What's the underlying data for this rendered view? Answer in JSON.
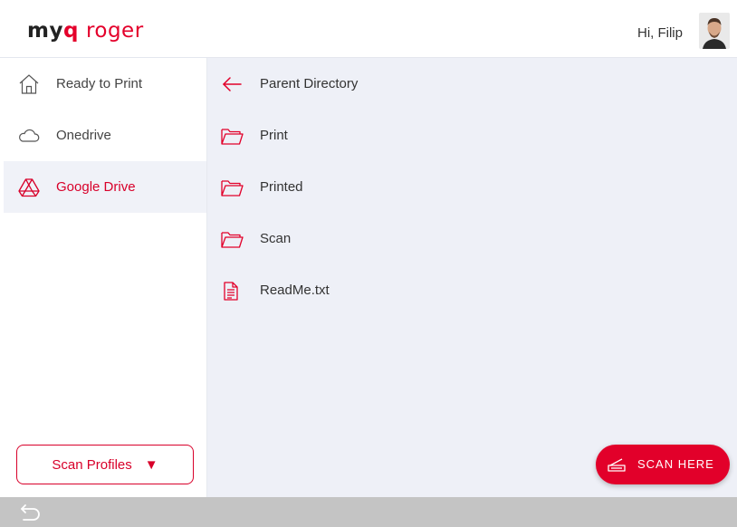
{
  "header": {
    "logo_myq_left": "my",
    "logo_myq_q": "q",
    "logo_roger": "roger",
    "greeting": "Hi, Filip"
  },
  "sidebar": {
    "items": [
      {
        "label": "Ready to Print",
        "icon": "home-icon",
        "active": false
      },
      {
        "label": "Onedrive",
        "icon": "cloud-icon",
        "active": false
      },
      {
        "label": "Google Drive",
        "icon": "google-drive-icon",
        "active": true
      }
    ],
    "scan_profiles_label": "Scan Profiles",
    "scan_profiles_caret": "▼"
  },
  "files": {
    "parent_label": "Parent Directory",
    "items": [
      {
        "name": "Print",
        "type": "folder"
      },
      {
        "name": "Printed",
        "type": "folder"
      },
      {
        "name": "Scan",
        "type": "folder"
      },
      {
        "name": "ReadMe.txt",
        "type": "file"
      }
    ]
  },
  "actions": {
    "scan_here_label": "SCAN HERE"
  },
  "colors": {
    "accent": "#e2002a",
    "main_bg": "#eef0f7",
    "sidebar_active_bg": "#f0f2f8",
    "bottom_bar": "#c4c4c4"
  }
}
